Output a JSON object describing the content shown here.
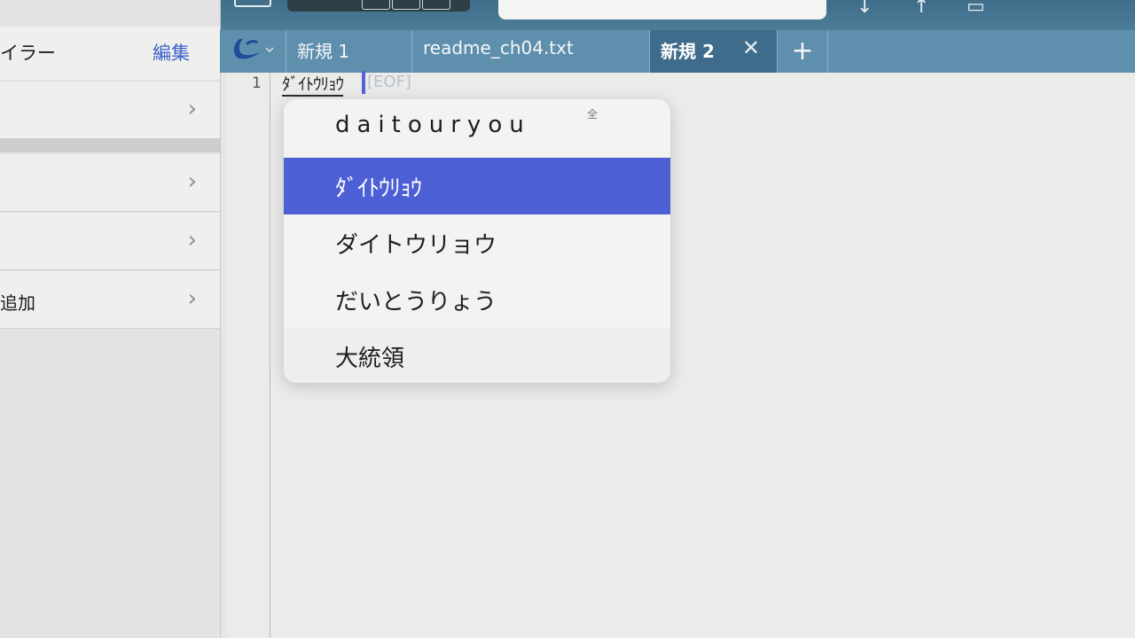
{
  "sidebar": {
    "title": "イラー",
    "edit_label": "編集",
    "rows": [
      {
        "label": ""
      },
      {
        "label": ""
      },
      {
        "label": ""
      },
      {
        "label": "追加"
      }
    ]
  },
  "tabs": [
    {
      "label": "新規 1",
      "active": false
    },
    {
      "label": "readme_ch04.txt",
      "active": false
    },
    {
      "label": "新規 2",
      "active": true
    }
  ],
  "editor": {
    "line_number": "1",
    "line_text": "ﾀﾞｲﾄｳﾘｮｳ",
    "eof_marker": "[EOF]"
  },
  "ime": {
    "badge": "全",
    "candidates": [
      {
        "text": "daitouryou",
        "selected": false
      },
      {
        "text": "ﾀﾞｲﾄｳﾘｮｳ",
        "selected": true
      },
      {
        "text": "ダイトウリョウ",
        "selected": false
      },
      {
        "text": "だいとうりょう",
        "selected": false
      },
      {
        "text": "大統領",
        "selected": false
      }
    ]
  },
  "icons": {
    "chevron": "chevron-right-icon",
    "close": "close-icon",
    "add": "plus-icon",
    "logo": "app-logo-icon"
  },
  "colors": {
    "accent": "#3a62c9",
    "tabbar": "#5e8fac",
    "active_tab": "#3e6c8a",
    "ime_selection": "#4d5fd5"
  }
}
